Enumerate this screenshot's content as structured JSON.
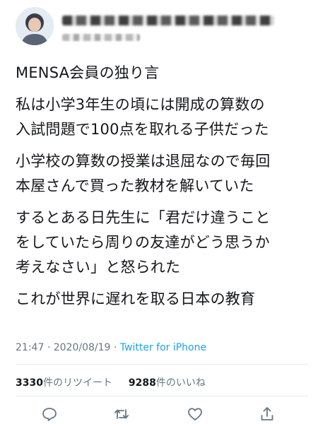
{
  "tweet": {
    "lines": [
      "MENSA会員の独り言",
      "私は小学3年生の頃には開成の算数の",
      "入試問題で100点を取れる子供だった",
      "小学校の算数の授業は退屈なので毎回",
      "本屋さんで買った教材を解いていた",
      "するとある日先生に「君だけ違うこと",
      "をしていたら周りの友達がどう思うか",
      "考えなさい」と怒られた",
      "これが世界に遅れを取る日本の教育"
    ],
    "time": "21:47",
    "date": "2020/08/19",
    "separator": "·",
    "source": "Twitter for iPhone"
  },
  "stats": {
    "retweets_count": "3330",
    "retweets_label": "件のリツイート",
    "likes_count": "9288",
    "likes_label": "件のいいね"
  },
  "icons": {
    "reply": "reply-icon",
    "retweet": "retweet-icon",
    "like": "like-icon",
    "share": "share-icon"
  },
  "colors": {
    "text": "#14171a",
    "meta": "#657786",
    "link": "#1da1f2",
    "divider": "#e6ecf0"
  }
}
